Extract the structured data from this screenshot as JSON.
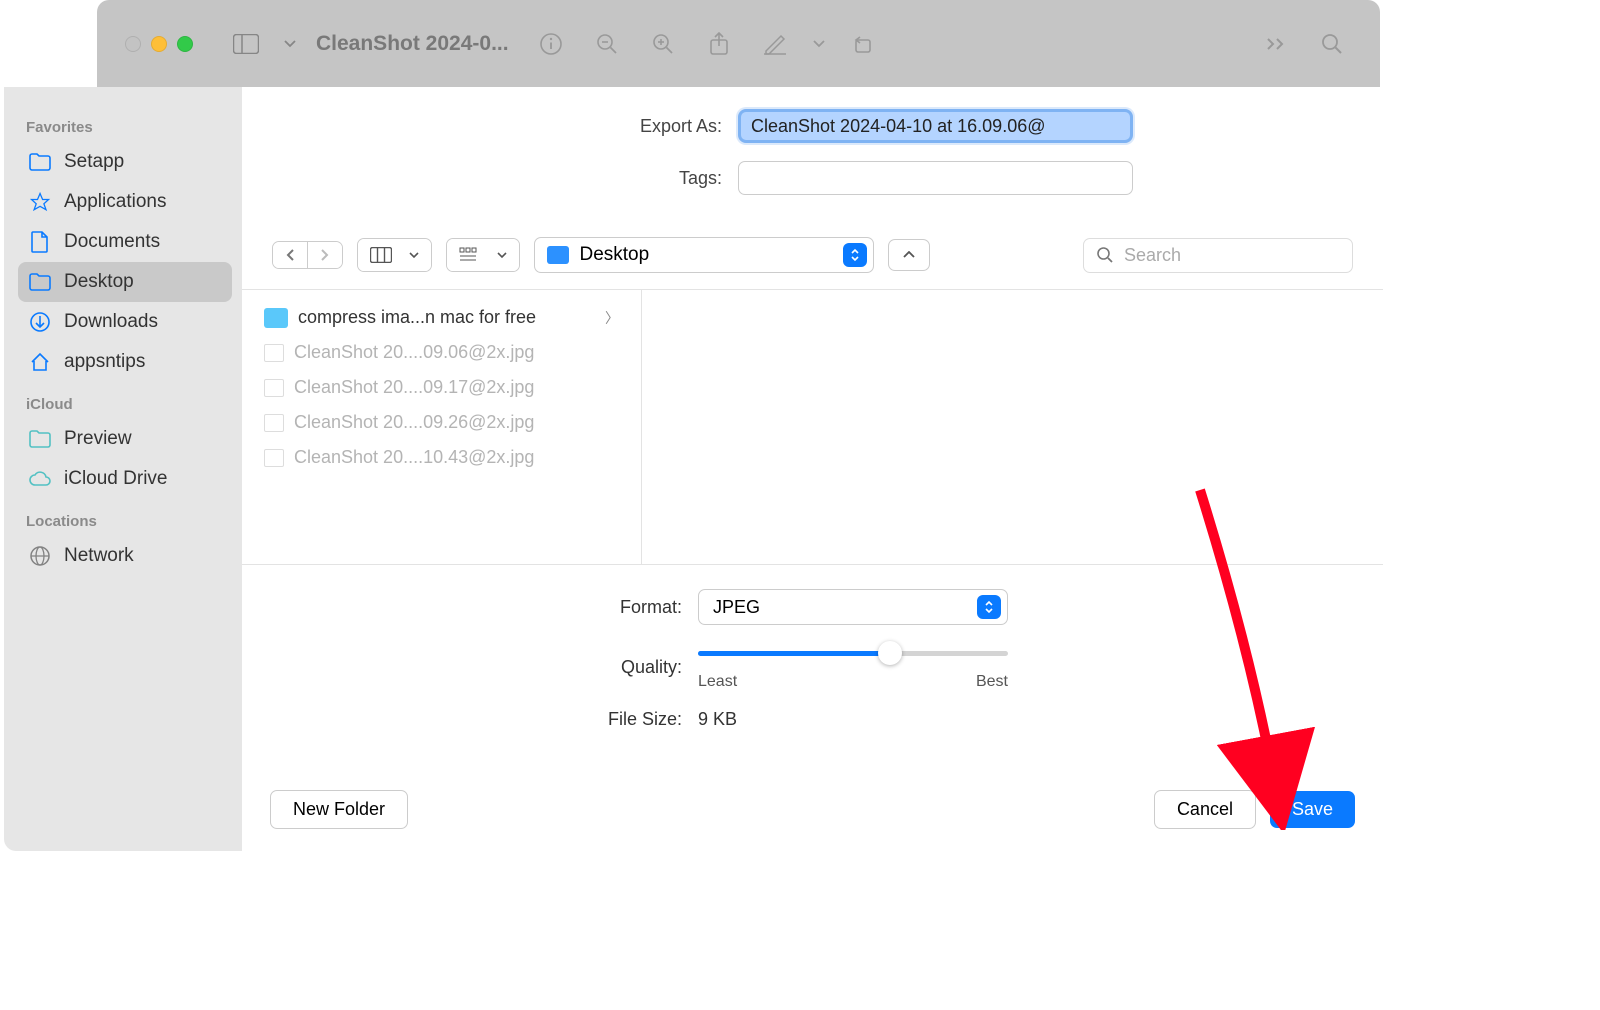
{
  "window": {
    "title": "CleanShot 2024-0..."
  },
  "export": {
    "label": "Export As:",
    "filename": "CleanShot 2024-04-10 at 16.09.06@",
    "tags_label": "Tags:"
  },
  "location": {
    "name": "Desktop"
  },
  "search": {
    "placeholder": "Search"
  },
  "sidebar": {
    "favorites_label": "Favorites",
    "icloud_label": "iCloud",
    "locations_label": "Locations",
    "items": [
      {
        "label": "Setapp"
      },
      {
        "label": "Applications"
      },
      {
        "label": "Documents"
      },
      {
        "label": "Desktop"
      },
      {
        "label": "Downloads"
      },
      {
        "label": "appsntips"
      },
      {
        "label": "Preview"
      },
      {
        "label": "iCloud Drive"
      },
      {
        "label": "Network"
      }
    ]
  },
  "files": {
    "folder": "compress ima...n mac for free",
    "items": [
      "CleanShot 20....09.06@2x.jpg",
      "CleanShot 20....09.17@2x.jpg",
      "CleanShot 20....09.26@2x.jpg",
      "CleanShot 20....10.43@2x.jpg"
    ]
  },
  "format": {
    "label": "Format:",
    "value": "JPEG",
    "quality_label": "Quality:",
    "quality_least": "Least",
    "quality_best": "Best",
    "file_size_label": "File Size:",
    "file_size_value": "9 KB"
  },
  "buttons": {
    "new_folder": "New Folder",
    "cancel": "Cancel",
    "save": "Save"
  }
}
